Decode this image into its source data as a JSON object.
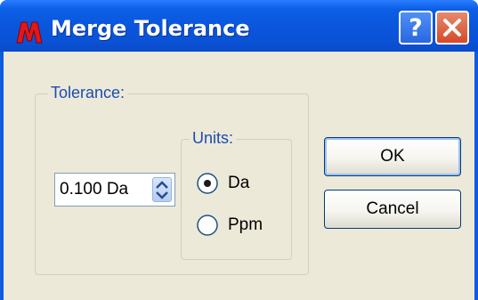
{
  "window": {
    "title": "Merge Tolerance",
    "help_button": "?",
    "close_button": "close"
  },
  "tolerance_group": {
    "label": "Tolerance:",
    "value": "0.100 Da"
  },
  "units_group": {
    "label": "Units:",
    "options": [
      {
        "label": "Da",
        "selected": true
      },
      {
        "label": "Ppm",
        "selected": false
      }
    ]
  },
  "buttons": {
    "ok": "OK",
    "cancel": "Cancel"
  },
  "colors": {
    "titlebar": "#0a56dc",
    "dialog_bg": "#ece9d8",
    "group_label": "#1c4bb4",
    "close_button": "#d64a28"
  }
}
